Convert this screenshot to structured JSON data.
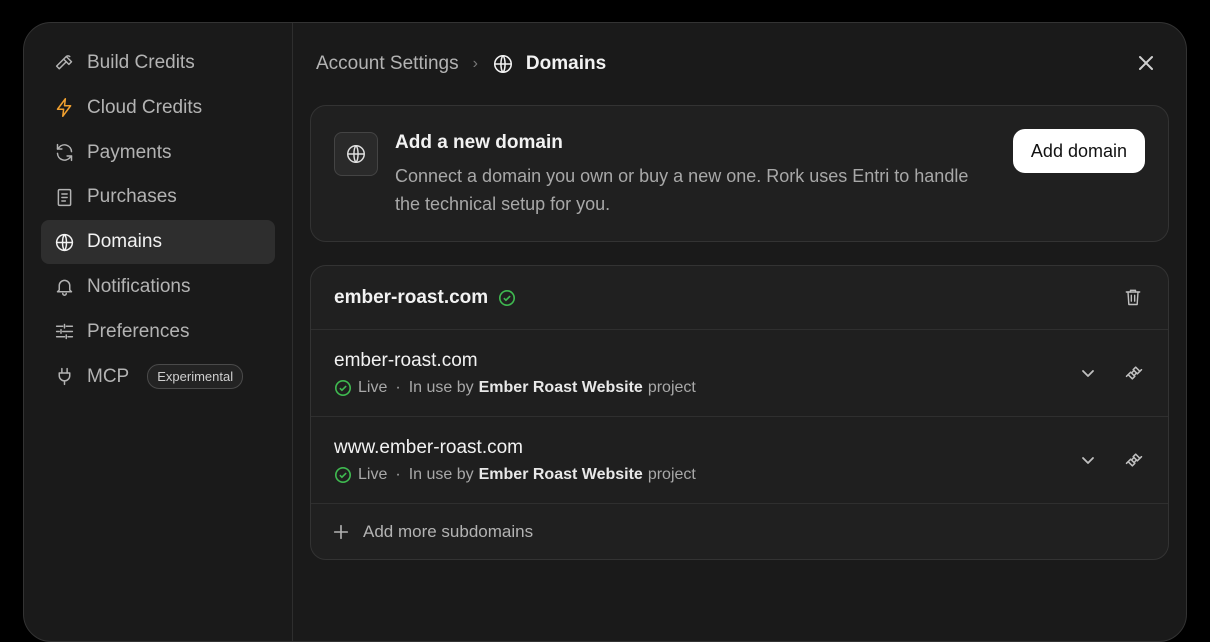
{
  "sidebar": {
    "items": [
      {
        "label": "Build Credits",
        "icon": "hammer-icon"
      },
      {
        "label": "Cloud Credits",
        "icon": "lightning-icon",
        "icon_color": "#f0a030"
      },
      {
        "label": "Payments",
        "icon": "refresh-icon"
      },
      {
        "label": "Purchases",
        "icon": "receipt-icon"
      },
      {
        "label": "Domains",
        "icon": "globe-icon",
        "active": true
      },
      {
        "label": "Notifications",
        "icon": "bell-icon"
      },
      {
        "label": "Preferences",
        "icon": "sliders-icon"
      },
      {
        "label": "MCP",
        "icon": "plug-icon",
        "badge": "Experimental"
      }
    ]
  },
  "header": {
    "breadcrumb_parent": "Account Settings",
    "breadcrumb_current": "Domains"
  },
  "add_domain": {
    "title": "Add a new domain",
    "description": "Connect a domain you own or buy a new one. Rork uses Entri to handle the technical setup for you.",
    "button_label": "Add domain"
  },
  "domain": {
    "name": "ember-roast.com",
    "verified_color": "#3fb950",
    "subdomains": [
      {
        "name": "ember-roast.com",
        "status": "Live",
        "separator": "·",
        "usage_prefix": "In use by",
        "project": "Ember Roast Website",
        "usage_suffix": "project"
      },
      {
        "name": "www.ember-roast.com",
        "status": "Live",
        "separator": "·",
        "usage_prefix": "In use by",
        "project": "Ember Roast Website",
        "usage_suffix": "project"
      }
    ],
    "add_more_label": "Add more subdomains"
  }
}
